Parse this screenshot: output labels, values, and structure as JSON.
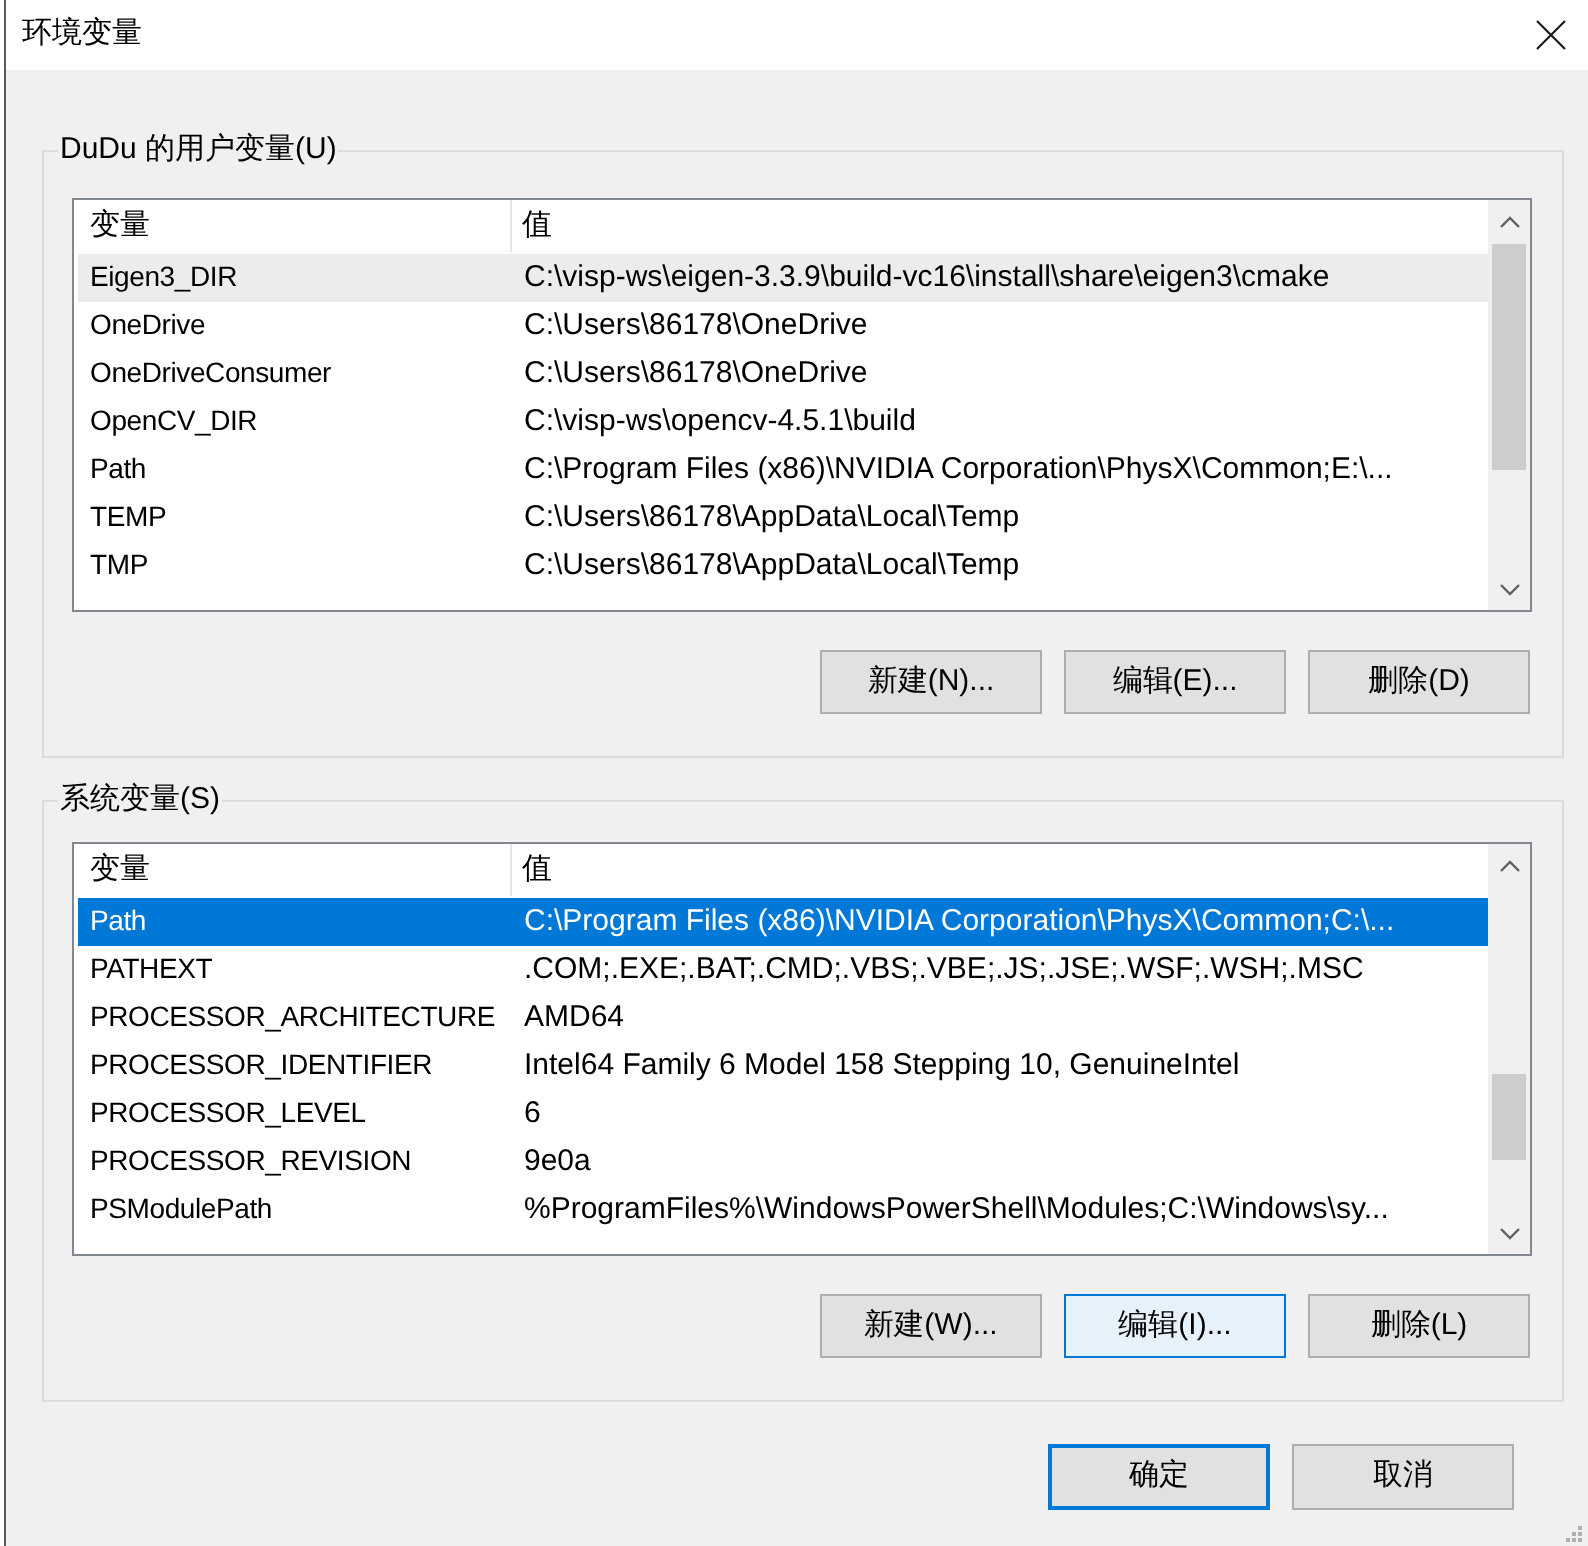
{
  "window": {
    "title": "环境变量"
  },
  "user_variables": {
    "label": "DuDu 的用户变量(U)",
    "focused": false,
    "columns": [
      "变量",
      "值"
    ],
    "rows": [
      {
        "name": "Eigen3_DIR",
        "value": "C:\\visp-ws\\eigen-3.3.9\\build-vc16\\install\\share\\eigen3\\cmake",
        "selected": true
      },
      {
        "name": "OneDrive",
        "value": "C:\\Users\\86178\\OneDrive",
        "selected": false
      },
      {
        "name": "OneDriveConsumer",
        "value": "C:\\Users\\86178\\OneDrive",
        "selected": false
      },
      {
        "name": "OpenCV_DIR",
        "value": "C:\\visp-ws\\opencv-4.5.1\\build",
        "selected": false
      },
      {
        "name": "Path",
        "value": "C:\\Program Files (x86)\\NVIDIA Corporation\\PhysX\\Common;E:\\...",
        "selected": false
      },
      {
        "name": "TEMP",
        "value": "C:\\Users\\86178\\AppData\\Local\\Temp",
        "selected": false
      },
      {
        "name": "TMP",
        "value": "C:\\Users\\86178\\AppData\\Local\\Temp",
        "selected": false
      }
    ],
    "buttons": [
      {
        "label": "新建(N)...",
        "hovered": false
      },
      {
        "label": "编辑(E)...",
        "hovered": false
      },
      {
        "label": "删除(D)",
        "hovered": false
      }
    ]
  },
  "system_variables": {
    "label": "系统变量(S)",
    "focused": true,
    "columns": [
      "变量",
      "值"
    ],
    "rows": [
      {
        "name": "Path",
        "value": "C:\\Program Files (x86)\\NVIDIA Corporation\\PhysX\\Common;C:\\...",
        "selected": true
      },
      {
        "name": "PATHEXT",
        "value": ".COM;.EXE;.BAT;.CMD;.VBS;.VBE;.JS;.JSE;.WSF;.WSH;.MSC",
        "selected": false
      },
      {
        "name": "PROCESSOR_ARCHITECTURE",
        "value": "AMD64",
        "selected": false
      },
      {
        "name": "PROCESSOR_IDENTIFIER",
        "value": "Intel64 Family 6 Model 158 Stepping 10, GenuineIntel",
        "selected": false
      },
      {
        "name": "PROCESSOR_LEVEL",
        "value": "6",
        "selected": false
      },
      {
        "name": "PROCESSOR_REVISION",
        "value": "9e0a",
        "selected": false
      },
      {
        "name": "PSModulePath",
        "value": "%ProgramFiles%\\WindowsPowerShell\\Modules;C:\\Windows\\sy...",
        "selected": false
      }
    ],
    "buttons": [
      {
        "label": "新建(W)...",
        "hovered": false
      },
      {
        "label": "编辑(I)...",
        "hovered": true
      },
      {
        "label": "删除(L)",
        "hovered": false
      }
    ]
  },
  "buttons": [
    {
      "label": "确定",
      "default": true
    },
    {
      "label": "取消",
      "default": false
    }
  ]
}
